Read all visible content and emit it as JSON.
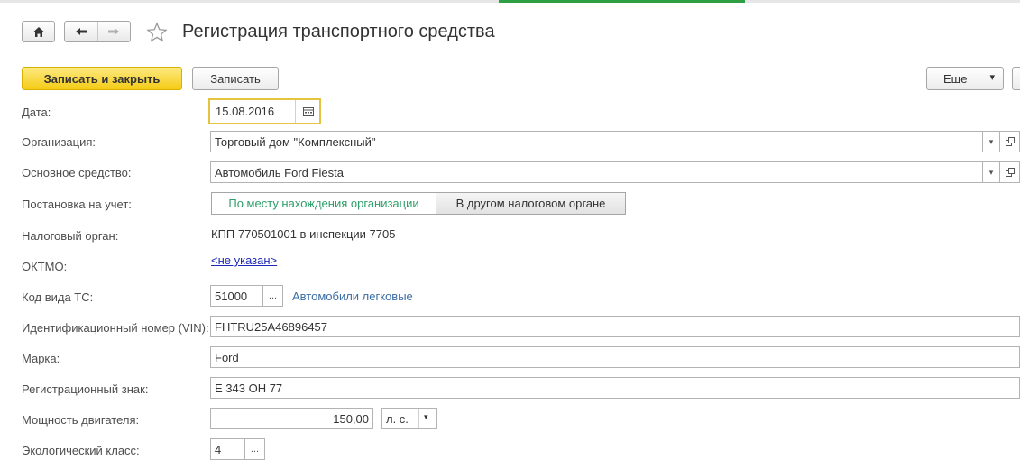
{
  "window": {
    "title": "Регистрация транспортного средства"
  },
  "toolbar": {
    "save_close_label": "Записать и закрыть",
    "save_label": "Записать",
    "more_label": "Еще",
    "more_arrow": "▾"
  },
  "icons": {
    "home": "home-icon",
    "back": "arrow-left-icon",
    "forward": "arrow-right-icon",
    "favorite": "star-icon",
    "calendar": "calendar-icon",
    "dropdown": "chevron-down-icon",
    "open": "open-window-icon",
    "select": "ellipsis-icon"
  },
  "form": {
    "date": {
      "label": "Дата:",
      "value": "15.08.2016"
    },
    "organization": {
      "label": "Организация:",
      "value": "Торговый дом \"Комплексный\""
    },
    "asset": {
      "label": "Основное средство:",
      "value": "Автомобиль Ford Fiesta"
    },
    "registration": {
      "label": "Постановка на учет:",
      "options": [
        "По месту нахождения организации",
        "В другом налоговом органе"
      ],
      "selected_index": 0
    },
    "tax_authority": {
      "label": "Налоговый орган:",
      "value": "КПП 770501001 в инспекции 7705"
    },
    "oktmo": {
      "label": "ОКТМО:",
      "value": "<не указан>"
    },
    "vehicle_code": {
      "label": "Код вида ТС:",
      "value": "51000",
      "select_label": "...",
      "description": "Автомобили легковые"
    },
    "vin": {
      "label": "Идентификационный номер (VIN):",
      "value": "FHTRU25A46896457"
    },
    "brand": {
      "label": "Марка:",
      "value": "Ford"
    },
    "reg_plate": {
      "label": "Регистрационный знак:",
      "value": "Е 343 ОН 77"
    },
    "engine_power": {
      "label": "Мощность двигателя:",
      "value": "150,00",
      "unit": "л. с.",
      "unit_arrow": "▾"
    },
    "eco_class": {
      "label": "Экологический класс:",
      "value": "4",
      "select_label": "..."
    }
  },
  "colors": {
    "accent_yellow": "#f5cc16",
    "focus_border": "#e3c340",
    "selected_option_text": "#2e9e6a",
    "link": "#1f2bb5",
    "hint": "#3b6ea5"
  }
}
